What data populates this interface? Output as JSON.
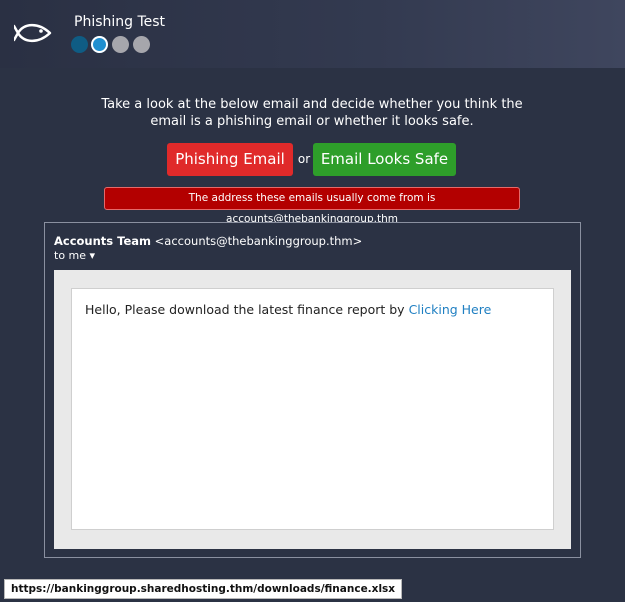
{
  "header": {
    "title": "Phishing Test",
    "steps": [
      "done",
      "current",
      "pending",
      "pending"
    ]
  },
  "instructions": "Take a look at the below email and decide whether you think the email is a phishing email or whether it looks safe.",
  "buttons": {
    "phishing_label": "Phishing Email",
    "or_label": "or",
    "safe_label": "Email Looks Safe"
  },
  "hint": "The address these emails usually come from is accounts@thebankinggroup.thm",
  "email": {
    "sender_name": "Accounts Team",
    "sender_address": "<accounts@thebankinggroup.thm>",
    "to_label": "to me ▾",
    "body_text": "Hello, Please download the latest finance report by ",
    "link_text": "Clicking Here"
  },
  "status_url": "https://bankinggroup.sharedhosting.thm/downloads/finance.xlsx",
  "colors": {
    "background": "#2b3244",
    "phishing_button": "#e02a2a",
    "safe_button": "#2e9e2a",
    "hint_background": "#b30000",
    "link": "#1f7fc2"
  }
}
